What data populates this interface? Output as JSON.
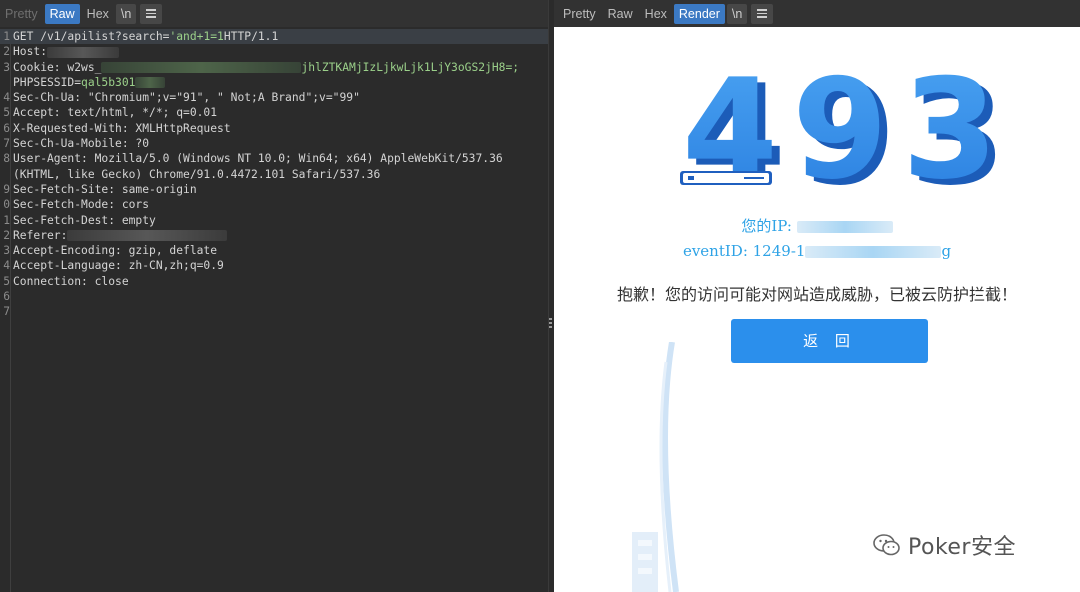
{
  "left_pane": {
    "tabs": [
      {
        "label": "Pretty",
        "state": "dim"
      },
      {
        "label": "Raw",
        "state": "active"
      },
      {
        "label": "Hex",
        "state": "normal"
      },
      {
        "label": "\\n",
        "state": "box"
      }
    ],
    "menu_icon": "hamburger-menu-icon",
    "request_lines": [
      {
        "num": "1",
        "parts": [
          {
            "t": "GET /v1/apilist?search="
          },
          {
            "t": "'and+1=1",
            "c": "green"
          },
          {
            "t": " HTTP/1.1"
          }
        ]
      },
      {
        "num": "2",
        "parts": [
          {
            "t": "Host: "
          },
          {
            "blur": 72
          }
        ]
      },
      {
        "num": "3",
        "parts": [
          {
            "t": "Cookie: w2ws_"
          },
          {
            "blur": 200,
            "green": true
          },
          {
            "t": "jhlZTKAMjIzLjkwLjk1LjY3oGS2jH8=;",
            "c": "green"
          }
        ]
      },
      {
        "num": "",
        "parts": [
          {
            "t": "PHPSESSID="
          },
          {
            "t": "qal5b301",
            "c": "green"
          },
          {
            "blur": 30,
            "green": true
          }
        ]
      },
      {
        "num": "4",
        "parts": [
          {
            "t": "Sec-Ch-Ua: \"Chromium\";v=\"91\", \" Not;A Brand\";v=\"99\""
          }
        ]
      },
      {
        "num": "5",
        "parts": [
          {
            "t": "Accept: text/html, */*; q=0.01"
          }
        ]
      },
      {
        "num": "6",
        "parts": [
          {
            "t": "X-Requested-With: XMLHttpRequest"
          }
        ]
      },
      {
        "num": "7",
        "parts": [
          {
            "t": "Sec-Ch-Ua-Mobile: ?0"
          }
        ]
      },
      {
        "num": "8",
        "parts": [
          {
            "t": "User-Agent: Mozilla/5.0 (Windows NT 10.0; Win64; x64) AppleWebKit/537.36"
          }
        ]
      },
      {
        "num": "",
        "parts": [
          {
            "t": "(KHTML, like Gecko) Chrome/91.0.4472.101 Safari/537.36"
          }
        ]
      },
      {
        "num": "9",
        "parts": [
          {
            "t": "Sec-Fetch-Site: same-origin"
          }
        ]
      },
      {
        "num": "0",
        "parts": [
          {
            "t": "Sec-Fetch-Mode: cors"
          }
        ]
      },
      {
        "num": "1",
        "parts": [
          {
            "t": "Sec-Fetch-Dest: empty"
          }
        ]
      },
      {
        "num": "2",
        "parts": [
          {
            "t": "Referer: "
          },
          {
            "blur": 160
          }
        ]
      },
      {
        "num": "3",
        "parts": [
          {
            "t": "Accept-Encoding: gzip, deflate"
          }
        ]
      },
      {
        "num": "4",
        "parts": [
          {
            "t": "Accept-Language: zh-CN,zh;q=0.9"
          }
        ]
      },
      {
        "num": "5",
        "parts": [
          {
            "t": "Connection: close"
          }
        ]
      },
      {
        "num": "6",
        "parts": []
      },
      {
        "num": "7",
        "parts": []
      }
    ]
  },
  "right_pane": {
    "tabs": [
      {
        "label": "Pretty",
        "state": "normal"
      },
      {
        "label": "Raw",
        "state": "normal"
      },
      {
        "label": "Hex",
        "state": "normal"
      },
      {
        "label": "Render",
        "state": "active"
      },
      {
        "label": "\\n",
        "state": "box-dim"
      }
    ],
    "menu_icon": "hamburger-menu-icon",
    "render": {
      "code": "493",
      "ip_label": "您的IP: ",
      "event_label": "eventID: 1249-1",
      "event_tail": "g",
      "message": "抱歉！您的访问可能对网站造成威胁，已被云防护拦截！",
      "back_button": "返 回",
      "accent_color": "#2b8fec",
      "info_color": "#2fa3e6"
    }
  },
  "watermark": {
    "icon": "wechat-icon",
    "text": "Poker安全"
  }
}
